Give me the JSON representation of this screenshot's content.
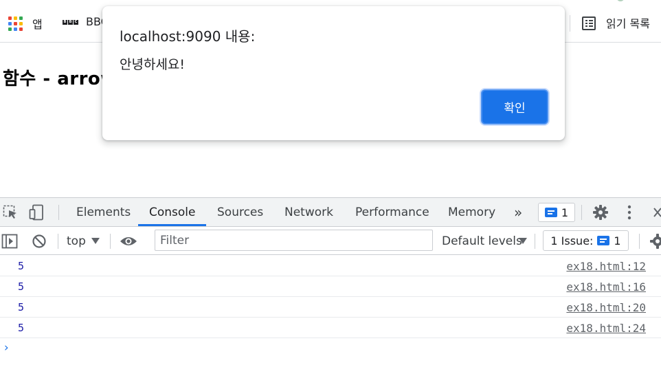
{
  "bookmarks": {
    "apps_label": "앱",
    "bbc_label": "BBC",
    "bbc_logo": [
      "B",
      "B",
      "C"
    ],
    "reading_list_label": "읽기 목록"
  },
  "page": {
    "heading": "함수 - arrow"
  },
  "alert": {
    "title": "localhost:9090 내용:",
    "message": "안녕하세요!",
    "ok_label": "확인"
  },
  "devtools": {
    "tabs": [
      "Elements",
      "Console",
      "Sources",
      "Network",
      "Performance",
      "Memory"
    ],
    "active_tab": "Console",
    "more_tabs_glyph": "»",
    "messages_badge": "1",
    "toolbar": {
      "context": "top",
      "filter_placeholder": "Filter",
      "levels": "Default levels",
      "issues_label": "1 Issue:",
      "issues_count": "1"
    },
    "console_rows": [
      {
        "value": "5",
        "source": "ex18.html:12"
      },
      {
        "value": "5",
        "source": "ex18.html:16"
      },
      {
        "value": "5",
        "source": "ex18.html:20"
      },
      {
        "value": "5",
        "source": "ex18.html:24"
      }
    ],
    "prompt": "›"
  },
  "colors": {
    "accent": "#1a73e8",
    "console_number": "#1a1aa6",
    "apps_dots": [
      "#ea4335",
      "#fbbc04",
      "#34a853",
      "#4285f4",
      "#ea4335",
      "#fbbc04",
      "#34a853",
      "#4285f4",
      "#ea4335"
    ]
  }
}
